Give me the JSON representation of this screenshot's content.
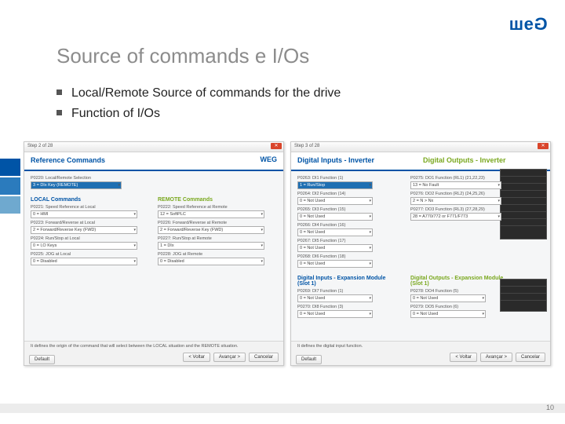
{
  "logo": "WEG",
  "title": "Source of commands e I/Os",
  "bullets": [
    "Local/Remote Source of commands for the drive",
    "Function of I/Os"
  ],
  "page_number": "10",
  "buttons": {
    "default": "Default",
    "back": "< Voltar",
    "next": "Avançar >",
    "cancel": "Cancelar"
  },
  "shot1": {
    "step": "Step 2 of 28",
    "header": "Reference Commands",
    "top_label": "P0220: Local/Remote Selection",
    "top_value": "3 = DIx Key (REMOTE)",
    "local_head": "LOCAL Commands",
    "remote_head": "REMOTE Commands",
    "local": [
      {
        "l": "P0221: Speed Reference at Local",
        "v": "0 = HMI"
      },
      {
        "l": "P0223: Forward/Reverse at Local",
        "v": "2 = Forward/Reverse Key (FWD)"
      },
      {
        "l": "P0224: Run/Stop at  Local",
        "v": "0 = I,O Keys"
      },
      {
        "l": "P0225: JOG at Local",
        "v": "0 = Disabled"
      }
    ],
    "remote": [
      {
        "l": "P0222: Speed Reference at Remote",
        "v": "12 = SoftPLC"
      },
      {
        "l": "P0226: Forward/Reverse at Remote",
        "v": "2 = Forward/Reverse Key (FWD)"
      },
      {
        "l": "P0227: Run/Stop at Remote",
        "v": "1 = DIx"
      },
      {
        "l": "P0228: JOG at Remote",
        "v": "0 = Disabled"
      }
    ],
    "hint": "It defines the origin of the command that will select between the LOCAL situation and the REMOTE situation."
  },
  "shot2": {
    "step": "Step 3 of 28",
    "di_head": "Digital Inputs - Inverter",
    "do_head": "Digital Outputs - Inverter",
    "di": [
      {
        "l": "P0263: DI1 Function (1)",
        "v": "1 = Run/Stop",
        "hl": true
      },
      {
        "l": "P0264: DI2 Function (14)",
        "v": "0 = Not Used"
      },
      {
        "l": "P0265: DI3 Function (15)",
        "v": "0 = Not Used"
      },
      {
        "l": "P0266: DI4 Function (16)",
        "v": "0 = Not Used"
      },
      {
        "l": "P0267: DI5 Function (17)",
        "v": "0 = Not Used"
      },
      {
        "l": "P0268: DI6 Function (18)",
        "v": "0 = Not Used"
      }
    ],
    "do": [
      {
        "l": "P0275: DO1 Function (RL1) (21,22,23)",
        "v": "13 = No Fault"
      },
      {
        "l": "P0276: DO2 Function (RL2) (24,25,26)",
        "v": "2 = N > Nx"
      },
      {
        "l": "P0277: DO3 Function (RL3) (27,28,29)",
        "v": "28 = A770/772 or F771/F773"
      }
    ],
    "diexp_head": "Digital Inputs - Expansion Module (Slot 1)",
    "doexp_head": "Digital Outputs - Expansion Module (Slot 1)",
    "diexp": [
      {
        "l": "P0269: DI7 Function (1)",
        "v": "0 = Not Used"
      },
      {
        "l": "P0270: DI8 Function (3)",
        "v": "0 = Not Used"
      }
    ],
    "doexp": [
      {
        "l": "P0278: DO4 Function (5)",
        "v": "0 = Not Used"
      },
      {
        "l": "P0279: DO5 Function (6)",
        "v": "0 = Not Used"
      }
    ],
    "hint": "It defines the digital input function."
  }
}
